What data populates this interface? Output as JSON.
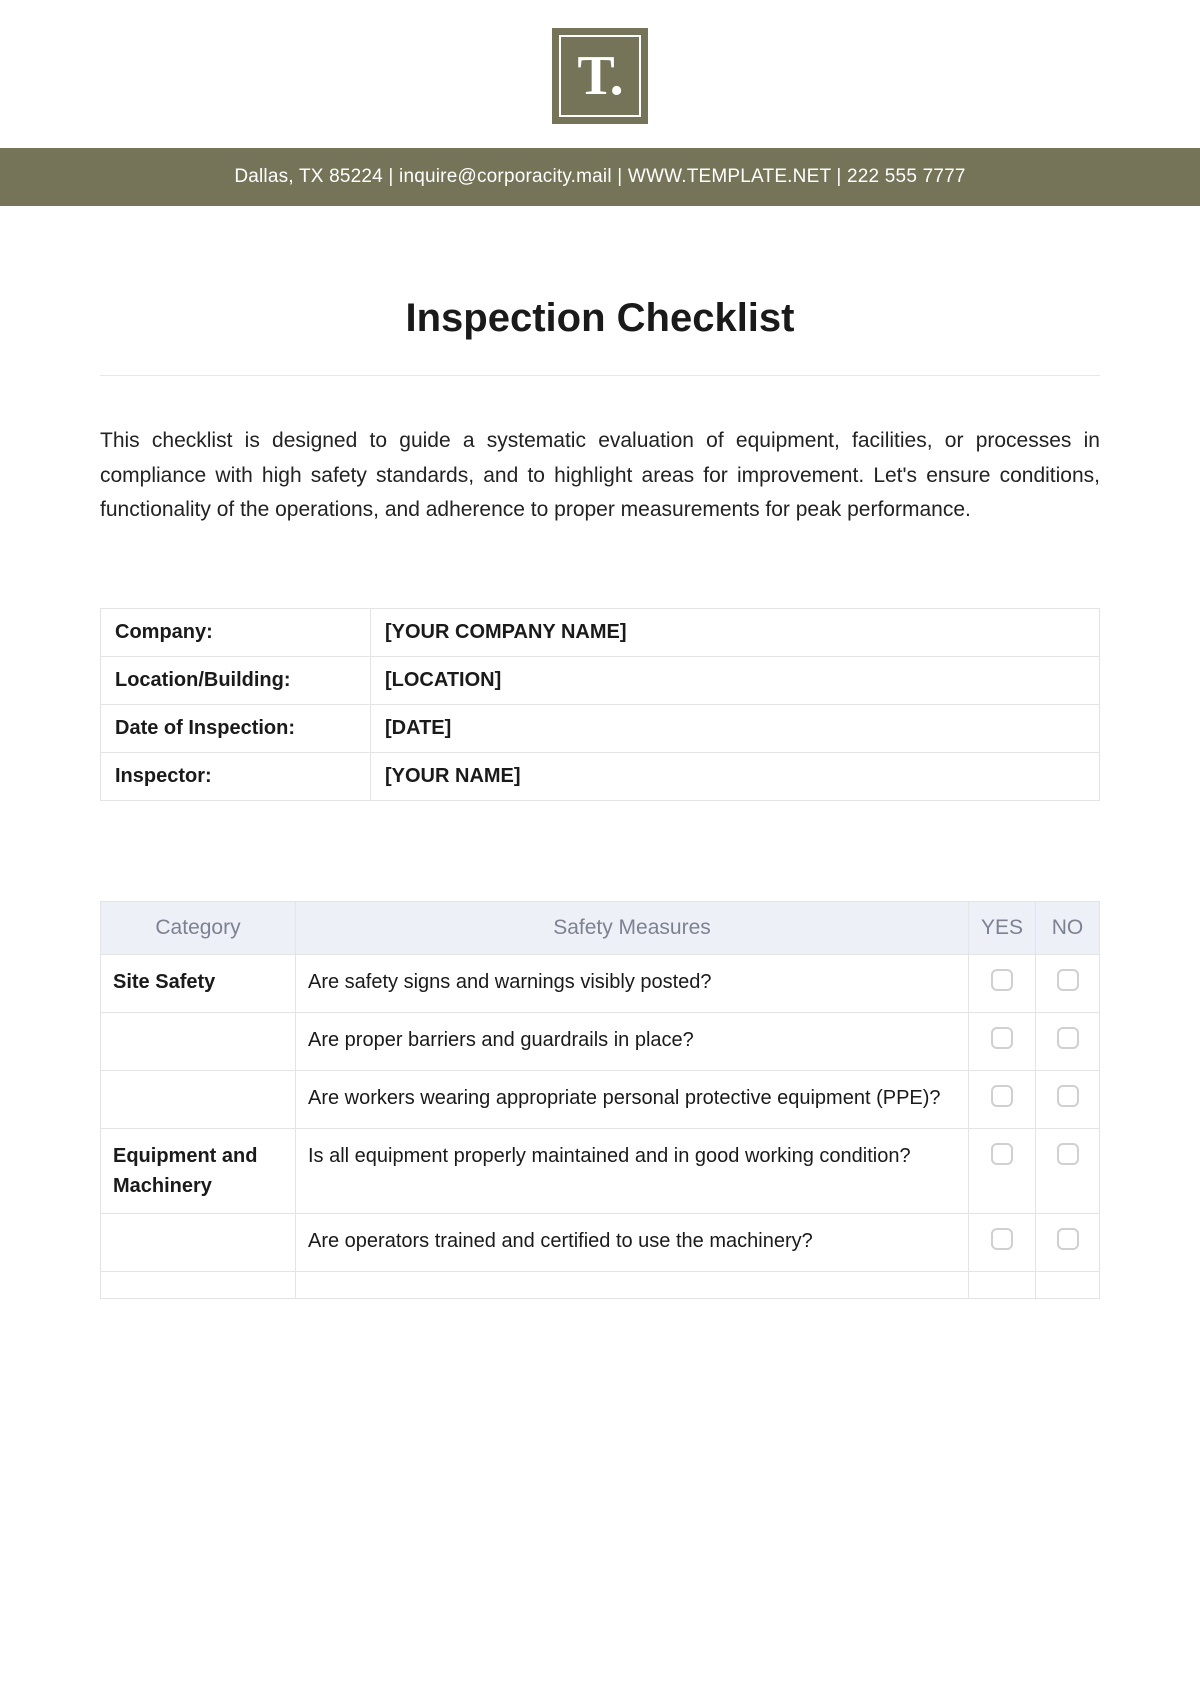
{
  "logo": {
    "text": "T."
  },
  "header": {
    "line": "Dallas, TX 85224 | inquire@corporacity.mail | WWW.TEMPLATE.NET | 222 555 7777"
  },
  "title": "Inspection Checklist",
  "intro": "This checklist is designed to guide a systematic evaluation of equipment, facilities, or processes in compliance with high safety standards, and to highlight areas for improvement. Let's ensure conditions, functionality of the operations, and adherence to proper measurements for peak performance.",
  "info": {
    "rows": [
      {
        "label": "Company:",
        "value": "[YOUR COMPANY NAME]"
      },
      {
        "label": "Location/Building:",
        "value": "[LOCATION]"
      },
      {
        "label": "Date of Inspection:",
        "value": "[DATE]"
      },
      {
        "label": "Inspector:",
        "value": "[YOUR NAME]"
      }
    ]
  },
  "checklist": {
    "headers": {
      "category": "Category",
      "measures": "Safety Measures",
      "yes": "YES",
      "no": "NO"
    },
    "rows": [
      {
        "category": "Site Safety",
        "measure": "Are safety signs and warnings visibly posted?"
      },
      {
        "category": "",
        "measure": "Are proper barriers and guardrails in place?"
      },
      {
        "category": "",
        "measure": "Are workers wearing appropriate personal protective equipment (PPE)?"
      },
      {
        "category": "Equipment and Machinery",
        "measure": "Is all equipment properly maintained and in good working condition?"
      },
      {
        "category": "",
        "measure": "Are operators trained and certified to use the machinery?"
      },
      {
        "category": "",
        "measure": ""
      }
    ]
  }
}
